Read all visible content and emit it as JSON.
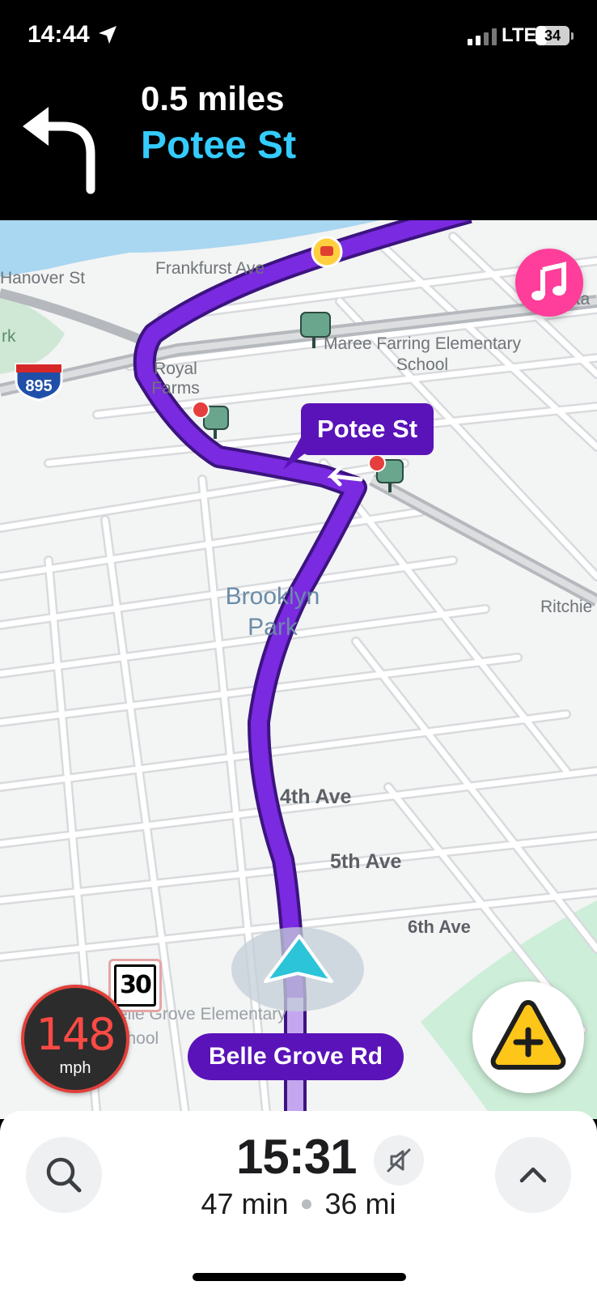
{
  "status_bar": {
    "time": "14:44",
    "network": "LTE",
    "battery": "34",
    "battery_level": 0.34
  },
  "maneuver": {
    "distance": "0.5 miles",
    "street": "Potee St",
    "direction_icon": "turn-left-icon"
  },
  "map": {
    "street_labels": [
      "Hanover St",
      "Frankfurst Ave",
      "Royal Farms",
      "Maree Farring Elementary School",
      "Ritchie",
      "Belle Grove Elementary School",
      "4th Ave",
      "5th Ave",
      "6th Ave"
    ],
    "highway_shield": "895",
    "area_label": "Brooklyn Park",
    "partial_labels": {
      "left_park": "rk",
      "right_edge": "ata"
    },
    "next_street_bubble": "Potee St",
    "current_road": "Belle Grove Rd",
    "route_color": "#6a1ccc",
    "accent_color": "#33ccff"
  },
  "speed": {
    "current": "148",
    "unit": "mph",
    "limit": "30"
  },
  "eta_panel": {
    "arrival_time": "15:31",
    "duration": "47 min",
    "distance": "36 mi"
  }
}
